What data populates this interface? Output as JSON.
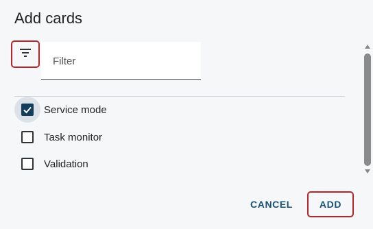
{
  "dialog": {
    "title": "Add cards",
    "filter": {
      "placeholder": "Filter",
      "value": "",
      "icon": "filter-icon"
    },
    "options": [
      {
        "label": "Service mode",
        "checked": true
      },
      {
        "label": "Task monitor",
        "checked": false
      },
      {
        "label": "Validation",
        "checked": false
      }
    ],
    "buttons": {
      "cancel_label": "CANCEL",
      "add_label": "ADD"
    }
  },
  "colors": {
    "accent": "#123f5e",
    "button_text": "#1a5276",
    "highlight_border": "#b3262c",
    "background": "#f6f7f9"
  }
}
